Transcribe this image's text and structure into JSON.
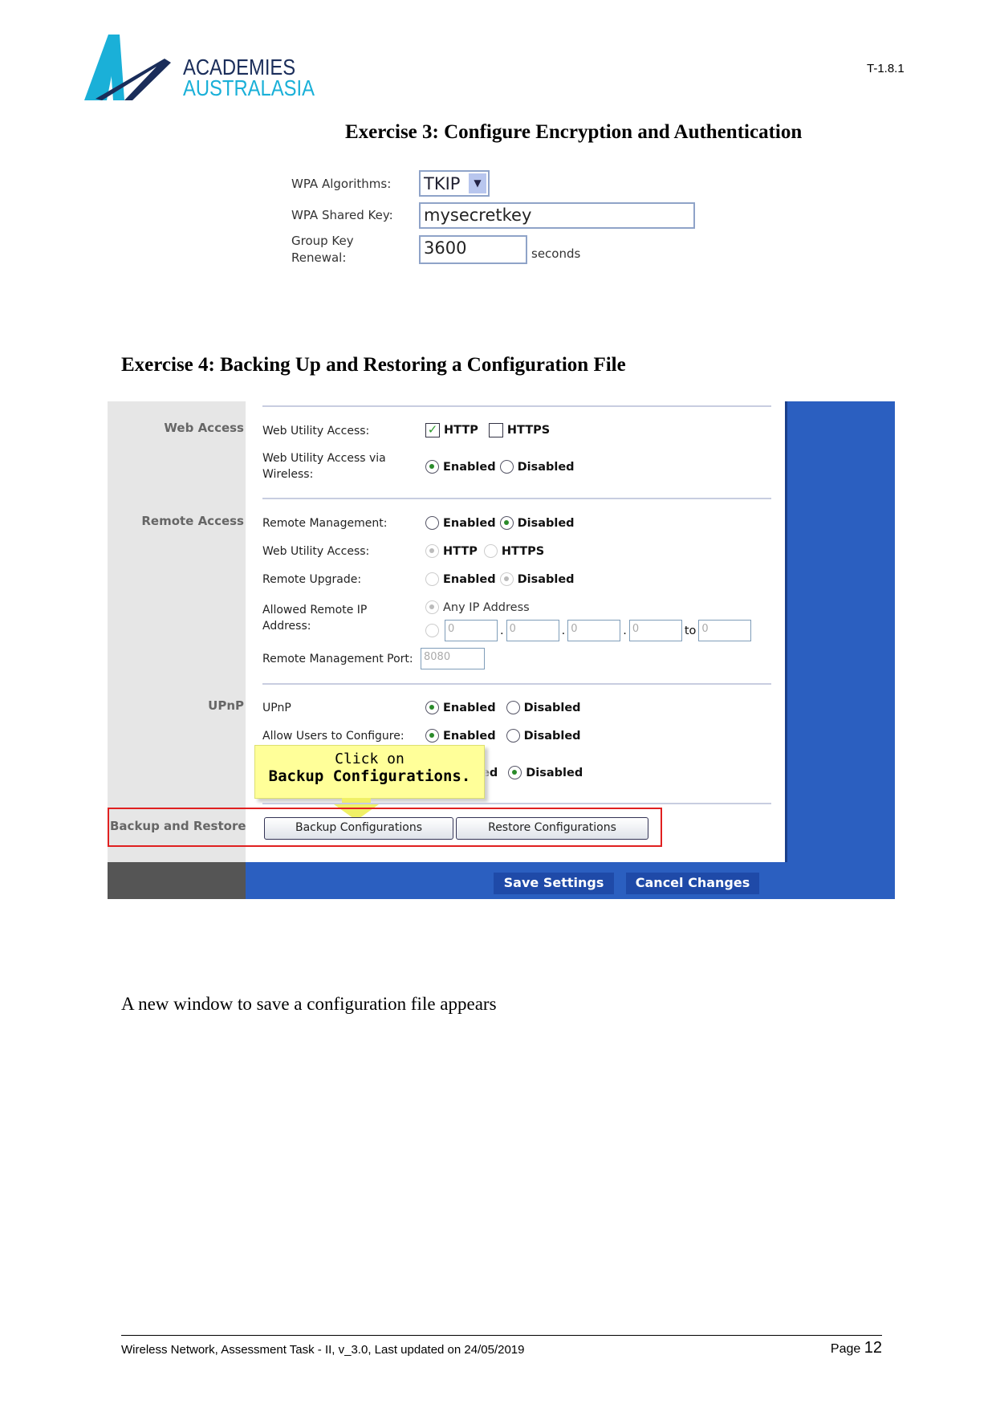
{
  "header": {
    "logo_line1": "ACADEMIES",
    "logo_line2": "AUSTRALASIA",
    "doc_code": "T-1.8.1"
  },
  "exercise3": {
    "title": "Exercise 3: Configure Encryption and Authentication",
    "wpa_algorithms_label": "WPA Algorithms:",
    "wpa_algorithms_value": "TKIP",
    "shared_key_label": "WPA Shared  Key:",
    "shared_key_value": "mysecretkey",
    "group_key_label_1": "Group Key",
    "group_key_label_2": "Renewal:",
    "group_key_value": "3600",
    "group_key_unit": "seconds"
  },
  "exercise4": {
    "title": "Exercise 4: Backing Up and Restoring a Configuration File"
  },
  "panel": {
    "sections": {
      "web_access": "Web Access",
      "remote_access": "Remote Access",
      "upnp": "UPnP",
      "backup": "Backup and Restore"
    },
    "web_utility_access": {
      "label": "Web Utility Access:",
      "http": "HTTP",
      "https": "HTTPS",
      "http_checked": true,
      "https_checked": false
    },
    "web_wireless": {
      "label1": "Web Utility Access via",
      "label2": "Wireless:",
      "enabled": "Enabled",
      "disabled": "Disabled",
      "selected": "Enabled"
    },
    "remote_mgmt": {
      "label": "Remote  Management:",
      "enabled": "Enabled",
      "disabled": "Disabled",
      "selected": "Disabled"
    },
    "remote_web": {
      "label": "Web Utility Access:",
      "http": "HTTP",
      "https": "HTTPS"
    },
    "remote_upgrade": {
      "label": "Remote Upgrade:",
      "enabled": "Enabled",
      "disabled": "Disabled"
    },
    "allowed_ip": {
      "label1": "Allowed Remote IP",
      "label2": "Address:",
      "any": "Any IP Address",
      "octets": [
        "0",
        "0",
        "0",
        "0"
      ],
      "to_label": "to",
      "to_value": "0"
    },
    "mgmt_port": {
      "label": "Remote Management Port:",
      "value": "8080"
    },
    "upnp": {
      "label": "UPnP",
      "enabled": "Enabled",
      "disabled": "Disabled",
      "selected": "Enabled"
    },
    "allow_config": {
      "label": "Allow Users to Configure:",
      "enabled": "Enabled",
      "disabled": "Disabled",
      "selected": "Enabled"
    },
    "third_row": {
      "partial": "ed",
      "disabled": "Disabled",
      "selected": "Disabled"
    },
    "tooltip": {
      "line1": "Click on",
      "line2": "Backup Configurations."
    },
    "backup_button": "Backup Configurations",
    "restore_button": "Restore Configurations",
    "save_button": "Save Settings",
    "cancel_button": "Cancel Changes"
  },
  "body_text": "A new window to save a configuration file appears",
  "footer": {
    "text": "Wireless Network, Assessment Task - II, v_3.0, Last updated on 24/05/2019",
    "page_label": "Page",
    "page_number": "12"
  },
  "colors": {
    "logo_cyan": "#1ab0d8",
    "logo_navy": "#1a2d5a",
    "panel_blue": "#2b5fc0",
    "highlight_red": "#e02020",
    "tooltip_yellow": "#ffff99"
  }
}
